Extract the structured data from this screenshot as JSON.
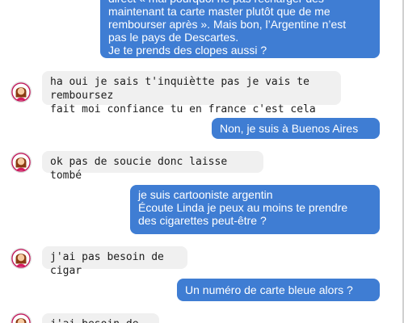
{
  "messages": [
    {
      "id": "m1",
      "sender": "me",
      "text": "direct « mai pourquoi ne pas recharger dès\nmaintenant ta carte master plutôt que de me\nrembourser après ». Mais bon, l’Argentine n’est\npas le pays de Descartes.\nJe te prends des clopes aussi ?"
    },
    {
      "id": "m2",
      "sender": "linda",
      "text": "ha oui je sais t'inquiètte pas je vais te remboursez\nfait moi confiance tu en france c'est cela"
    },
    {
      "id": "m3",
      "sender": "me",
      "text": "Non, je suis à Buenos Aires"
    },
    {
      "id": "m4",
      "sender": "linda",
      "text": "ok pas de soucie donc laisse tombé"
    },
    {
      "id": "m5",
      "sender": "me",
      "text": "je suis cartooniste argentin\nÉcoute Linda je peux au moins te prendre\ndes cigarettes peut-être ?"
    },
    {
      "id": "m6",
      "sender": "linda",
      "text": "j'ai pas besoin de cigar"
    },
    {
      "id": "m7",
      "sender": "me",
      "text": "Un numéro de carte bleue alors ?"
    },
    {
      "id": "m8",
      "sender": "linda",
      "text": "j'ai besoin de PCS"
    }
  ],
  "colors": {
    "sent_bubble": "#3f7dd3",
    "received_bubble": "#f0f0f0",
    "avatar_ring": "#c2185b"
  },
  "icons": {
    "avatar": "woman-avatar-icon"
  }
}
